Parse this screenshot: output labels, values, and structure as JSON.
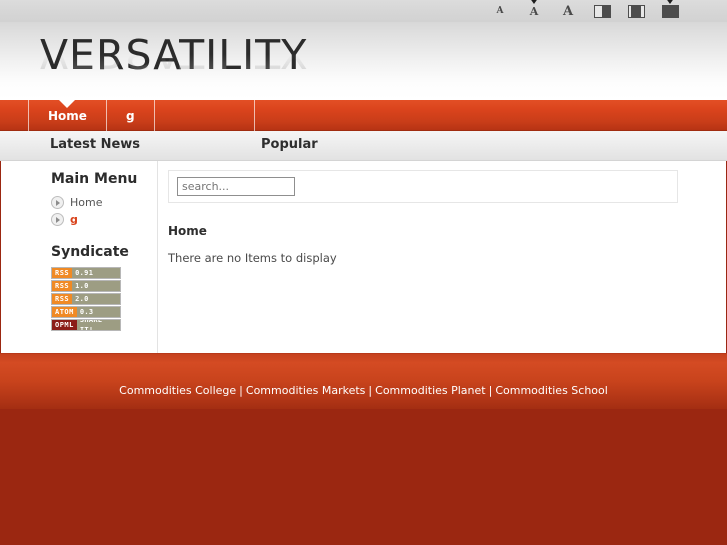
{
  "topbar": {
    "font_tools": [
      {
        "name": "decrease-font",
        "glyph": "A",
        "selected": false
      },
      {
        "name": "default-font",
        "glyph": "A",
        "selected": true
      },
      {
        "name": "increase-font",
        "glyph": "A",
        "selected": false
      }
    ],
    "contrast_tools": [
      {
        "name": "contrast-low",
        "selected": false
      },
      {
        "name": "contrast-medium",
        "selected": false
      },
      {
        "name": "contrast-high",
        "selected": true
      }
    ]
  },
  "header": {
    "logo": "VERSATILITY"
  },
  "nav": {
    "items": [
      {
        "label": "Home",
        "active": true
      },
      {
        "label": "g",
        "active": false
      }
    ]
  },
  "subheader": {
    "latest_news": "Latest News",
    "popular": "Popular"
  },
  "sidebar": {
    "main_menu": {
      "title": "Main Menu",
      "items": [
        {
          "label": "Home",
          "accent": false
        },
        {
          "label": "g",
          "accent": true
        }
      ]
    },
    "syndicate": {
      "title": "Syndicate",
      "badges": [
        {
          "type": "rss",
          "tag": "RSS",
          "value": "0.91"
        },
        {
          "type": "rss",
          "tag": "RSS",
          "value": "1.0"
        },
        {
          "type": "rss",
          "tag": "RSS",
          "value": "2.0"
        },
        {
          "type": "atom",
          "tag": "ATOM",
          "value": "0.3"
        },
        {
          "type": "opml",
          "tag": "OPML",
          "value": "SHARE IT!"
        }
      ]
    }
  },
  "main": {
    "search": {
      "placeholder": "search...",
      "value": ""
    },
    "article": {
      "title": "Home",
      "body": "There are no Items to display"
    }
  },
  "footer": {
    "separator": "|",
    "links": [
      "Commodities College",
      "Commodities Markets",
      "Commodities Planet",
      "Commodities School"
    ]
  },
  "colors": {
    "brand_orange": "#d9431c",
    "brand_dark_red": "#9b2711",
    "badge_orange": "#f08a24",
    "badge_olive": "#9d9d83",
    "badge_opml_red": "#8b1c18"
  }
}
